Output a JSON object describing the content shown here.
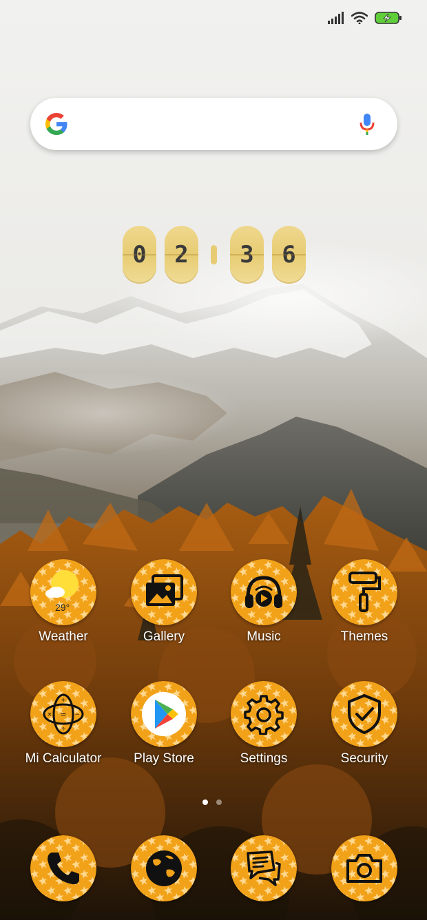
{
  "clock": {
    "h1": "0",
    "h2": "2",
    "m1": "3",
    "m2": "6"
  },
  "weather": {
    "temperature": "29°"
  },
  "apps_row1": [
    {
      "label": "Weather",
      "icon": "sun-cloud-icon"
    },
    {
      "label": "Gallery",
      "icon": "image-stack-icon"
    },
    {
      "label": "Music",
      "icon": "headphones-icon"
    },
    {
      "label": "Themes",
      "icon": "paint-roller-icon"
    }
  ],
  "apps_row2": [
    {
      "label": "Mi Calculator",
      "icon": "calculator-icon"
    },
    {
      "label": "Play Store",
      "icon": "play-store-icon"
    },
    {
      "label": "Settings",
      "icon": "gear-icon"
    },
    {
      "label": "Security",
      "icon": "shield-check-icon"
    }
  ],
  "dock": [
    {
      "icon": "phone-icon"
    },
    {
      "icon": "globe-icon"
    },
    {
      "icon": "messages-icon"
    },
    {
      "icon": "camera-icon"
    }
  ],
  "colors": {
    "icon_orange": "#f2a219",
    "icon_pattern": "#ffd88f",
    "clock_yellow": "#e7cc73",
    "battery_green": "#5fce3a"
  }
}
